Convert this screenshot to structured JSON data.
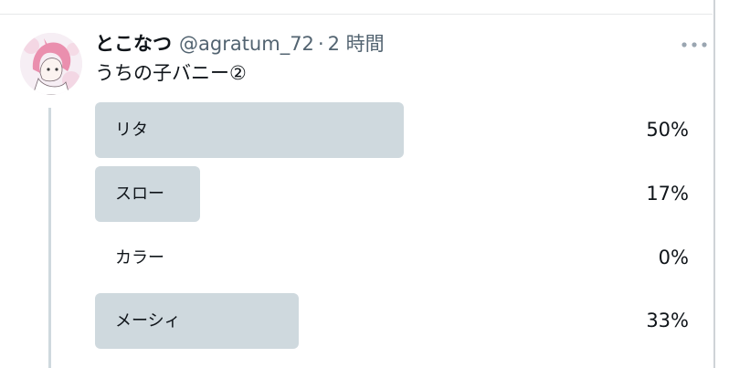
{
  "tweet": {
    "display_name": "とこなつ",
    "handle": "@agratum_72",
    "separator": "·",
    "time": "2 時間",
    "text": "うちの子バニー②",
    "more_icon": "more-horizontal-icon"
  },
  "poll": {
    "options": [
      {
        "label": "リタ",
        "percent": "50%",
        "fraction": 0.5
      },
      {
        "label": "スロー",
        "percent": "17%",
        "fraction": 0.17
      },
      {
        "label": "カラー",
        "percent": "0%",
        "fraction": 0.0
      },
      {
        "label": "メーシィ",
        "percent": "33%",
        "fraction": 0.33
      }
    ]
  },
  "colors": {
    "bar": "#cfd9de",
    "text": "#0f1419",
    "muted": "#536471",
    "thread_line": "#cfd9de"
  }
}
